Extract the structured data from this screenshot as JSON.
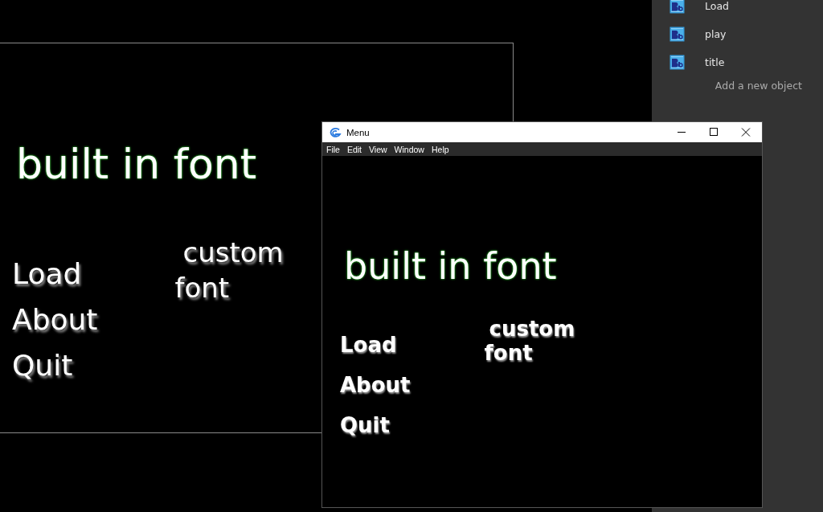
{
  "scene": {
    "heading": "built in font",
    "menu_items": [
      "Load",
      "About",
      "Quit"
    ],
    "custom_lines": [
      "custom",
      "font"
    ]
  },
  "object_panel": {
    "objects": [
      "Load",
      "play",
      "title"
    ],
    "add_label": "Add a new object"
  },
  "preview_window": {
    "title": "Menu",
    "menu": [
      "File",
      "Edit",
      "View",
      "Window",
      "Help"
    ],
    "heading": "built in font",
    "menu_items": [
      "Load",
      "About",
      "Quit"
    ],
    "custom_lines": [
      "custom",
      "font"
    ]
  }
}
